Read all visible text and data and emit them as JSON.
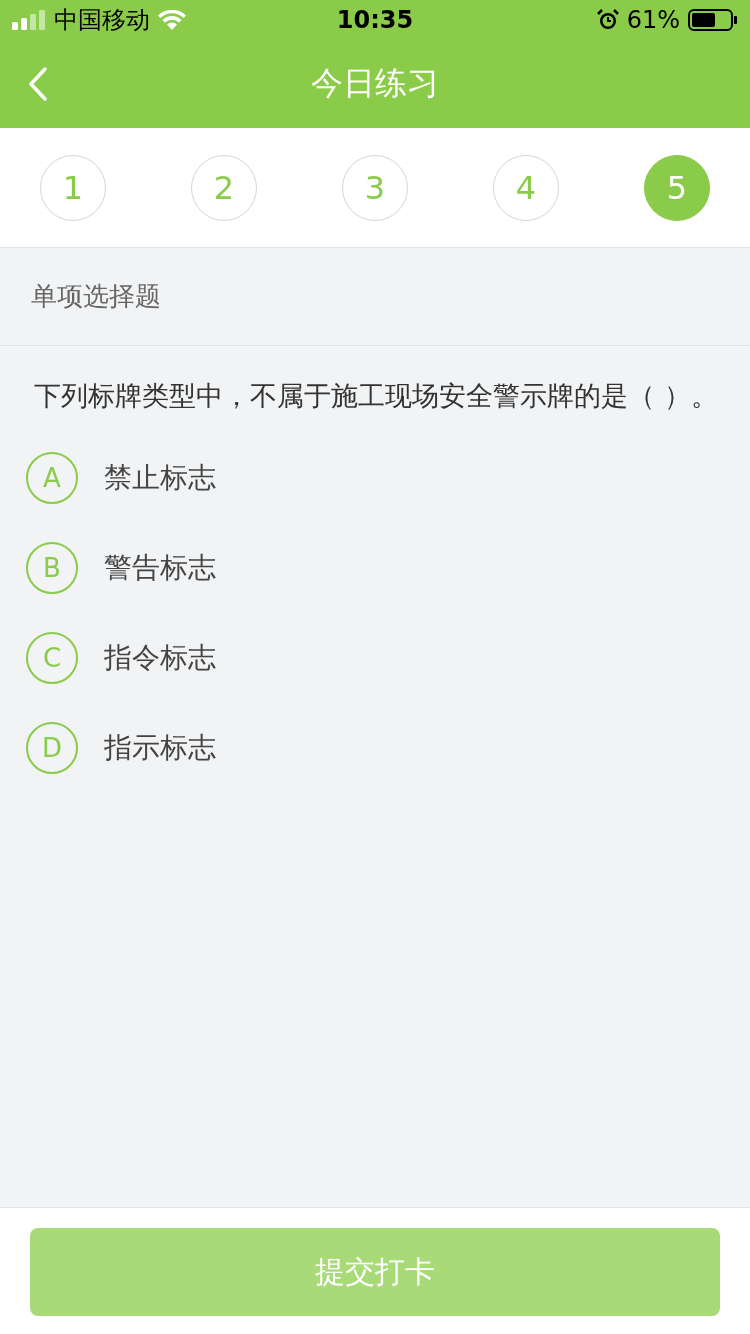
{
  "status_bar": {
    "carrier": "中国移动",
    "time": "10:35",
    "battery": "61%"
  },
  "nav": {
    "title": "今日练习"
  },
  "steps": [
    {
      "label": "1",
      "selected": false
    },
    {
      "label": "2",
      "selected": false
    },
    {
      "label": "3",
      "selected": false
    },
    {
      "label": "4",
      "selected": false
    },
    {
      "label": "5",
      "selected": true
    }
  ],
  "section": {
    "label": "单项选择题"
  },
  "question": {
    "text": "下列标牌类型中，不属于施工现场安全警示牌的是（ ）。"
  },
  "options": [
    {
      "letter": "A",
      "text": "禁止标志",
      "selected": false
    },
    {
      "letter": "B",
      "text": "警告标志",
      "selected": false
    },
    {
      "letter": "C",
      "text": "指令标志",
      "selected": false
    },
    {
      "letter": "D",
      "text": "指示标志",
      "selected": false
    }
  ],
  "submit": {
    "label": "提交打卡",
    "disabled": true
  }
}
